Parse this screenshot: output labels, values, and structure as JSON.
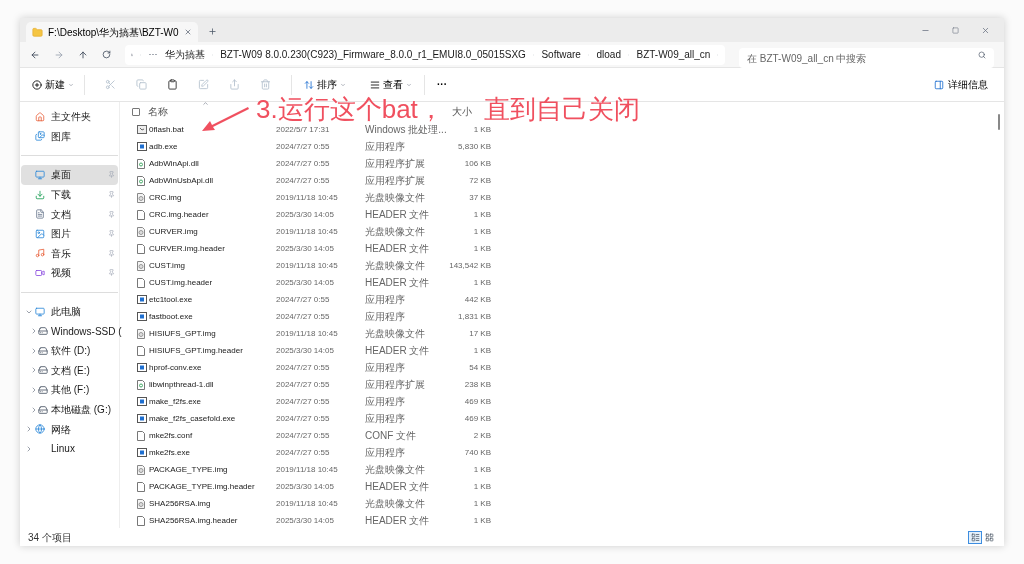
{
  "window": {
    "tab_title": "F:\\Desktop\\华为搞基\\BZT-W0"
  },
  "address": {
    "overflow": "···",
    "crumbs": [
      "华为搞基",
      "BZT-W09 8.0.0.230(C923)_Firmware_8.0.0_r1_EMUI8.0_05015SXG",
      "Software",
      "dload",
      "BZT-W09_all_cn"
    ],
    "search_placeholder": "在 BZT-W09_all_cn 中搜索"
  },
  "toolbar": {
    "new_label": "新建",
    "icon_buttons": [
      {
        "disabled": true
      },
      {
        "disabled": true
      },
      {
        "disabled": false
      },
      {
        "disabled": true
      },
      {
        "disabled": true
      },
      {
        "disabled": true
      }
    ],
    "sort_label": "排序",
    "view_label": "查看",
    "more_label": "···",
    "details_label": "详细信息"
  },
  "sidebar": {
    "groups": [
      [
        {
          "label": "主文件夹",
          "selected": false
        },
        {
          "label": "图库",
          "selected": false
        }
      ],
      [
        {
          "label": "桌面",
          "selected": true,
          "pinned": true
        },
        {
          "label": "下载",
          "selected": false,
          "pinned": true
        },
        {
          "label": "文档",
          "selected": false,
          "pinned": true
        },
        {
          "label": "图片",
          "selected": false,
          "pinned": true
        },
        {
          "label": "音乐",
          "selected": false,
          "pinned": true
        },
        {
          "label": "视频",
          "selected": false,
          "pinned": true
        }
      ],
      [
        {
          "label": "此电脑",
          "selected": false,
          "expanded": true,
          "children": [
            {
              "label": "Windows-SSD (",
              "selected": false,
              "expanded": false
            },
            {
              "label": "软件 (D:)",
              "selected": false,
              "expanded": false
            },
            {
              "label": "文档 (E:)",
              "selected": false,
              "expanded": false
            },
            {
              "label": "其他 (F:)",
              "selected": false,
              "expanded": false
            },
            {
              "label": "本地磁盘 (G:)",
              "selected": false,
              "expanded": false
            }
          ]
        },
        {
          "label": "网络",
          "selected": false,
          "expanded": false
        },
        {
          "label": "Linux",
          "selected": false,
          "expanded": false
        }
      ]
    ]
  },
  "table": {
    "select_all_checked": false,
    "columns": [
      {
        "label": "名称",
        "sorted": true
      },
      {
        "label": "大小"
      }
    ],
    "rows": [
      {
        "kind": "script",
        "name": "0flash.bat",
        "date": "2022/5/7 17:31",
        "type": "Windows 批处理...",
        "size": "1 KB"
      },
      {
        "kind": "app",
        "name": "adb.exe",
        "date": "2024/7/27 0:55",
        "type": "应用程序",
        "size": "5,830 KB"
      },
      {
        "kind": "library",
        "name": "AdbWinApi.dll",
        "date": "2024/7/27 0:55",
        "type": "应用程序扩展",
        "size": "106 KB"
      },
      {
        "kind": "library",
        "name": "AdbWinUsbApi.dll",
        "date": "2024/7/27 0:55",
        "type": "应用程序扩展",
        "size": "72 KB"
      },
      {
        "kind": "disc",
        "name": "CRC.img",
        "date": "2019/11/18 10:45",
        "type": "光盘映像文件",
        "size": "37 KB"
      },
      {
        "kind": "blank",
        "name": "CRC.img.header",
        "date": "2025/3/30 14:05",
        "type": "HEADER 文件",
        "size": "1 KB"
      },
      {
        "kind": "disc",
        "name": "CURVER.img",
        "date": "2019/11/18 10:45",
        "type": "光盘映像文件",
        "size": "1 KB"
      },
      {
        "kind": "blank",
        "name": "CURVER.img.header",
        "date": "2025/3/30 14:05",
        "type": "HEADER 文件",
        "size": "1 KB"
      },
      {
        "kind": "disc",
        "name": "CUST.img",
        "date": "2019/11/18 10:45",
        "type": "光盘映像文件",
        "size": "143,542 KB"
      },
      {
        "kind": "blank",
        "name": "CUST.img.header",
        "date": "2025/3/30 14:05",
        "type": "HEADER 文件",
        "size": "1 KB"
      },
      {
        "kind": "app",
        "name": "etc1tool.exe",
        "date": "2024/7/27 0:55",
        "type": "应用程序",
        "size": "442 KB"
      },
      {
        "kind": "app",
        "name": "fastboot.exe",
        "date": "2024/7/27 0:55",
        "type": "应用程序",
        "size": "1,831 KB"
      },
      {
        "kind": "disc",
        "name": "HISIUFS_GPT.img",
        "date": "2019/11/18 10:45",
        "type": "光盘映像文件",
        "size": "17 KB"
      },
      {
        "kind": "blank",
        "name": "HISIUFS_GPT.img.header",
        "date": "2025/3/30 14:05",
        "type": "HEADER 文件",
        "size": "1 KB"
      },
      {
        "kind": "app",
        "name": "hprof-conv.exe",
        "date": "2024/7/27 0:55",
        "type": "应用程序",
        "size": "54 KB"
      },
      {
        "kind": "library",
        "name": "libwinpthread-1.dll",
        "date": "2024/7/27 0:55",
        "type": "应用程序扩展",
        "size": "238 KB"
      },
      {
        "kind": "app",
        "name": "make_f2fs.exe",
        "date": "2024/7/27 0:55",
        "type": "应用程序",
        "size": "469 KB"
      },
      {
        "kind": "app",
        "name": "make_f2fs_casefold.exe",
        "date": "2024/7/27 0:55",
        "type": "应用程序",
        "size": "469 KB"
      },
      {
        "kind": "blank",
        "name": "mke2fs.conf",
        "date": "2024/7/27 0:55",
        "type": "CONF 文件",
        "size": "2 KB"
      },
      {
        "kind": "app",
        "name": "mke2fs.exe",
        "date": "2024/7/27 0:55",
        "type": "应用程序",
        "size": "740 KB"
      },
      {
        "kind": "disc",
        "name": "PACKAGE_TYPE.img",
        "date": "2019/11/18 10:45",
        "type": "光盘映像文件",
        "size": "1 KB"
      },
      {
        "kind": "blank",
        "name": "PACKAGE_TYPE.img.header",
        "date": "2025/3/30 14:05",
        "type": "HEADER 文件",
        "size": "1 KB"
      },
      {
        "kind": "disc",
        "name": "SHA256RSA.img",
        "date": "2019/11/18 10:45",
        "type": "光盘映像文件",
        "size": "1 KB"
      },
      {
        "kind": "blank",
        "name": "SHA256RSA.img.header",
        "date": "2025/3/30 14:05",
        "type": "HEADER 文件",
        "size": "1 KB"
      }
    ]
  },
  "annotation": {
    "parts": [
      "3.运行这个bat，",
      "直到自己关闭"
    ]
  },
  "status_bar": {
    "count": "34 个项目",
    "views": [
      {
        "kind": "details",
        "selected": true
      },
      {
        "kind": "tiles",
        "selected": false
      }
    ]
  }
}
